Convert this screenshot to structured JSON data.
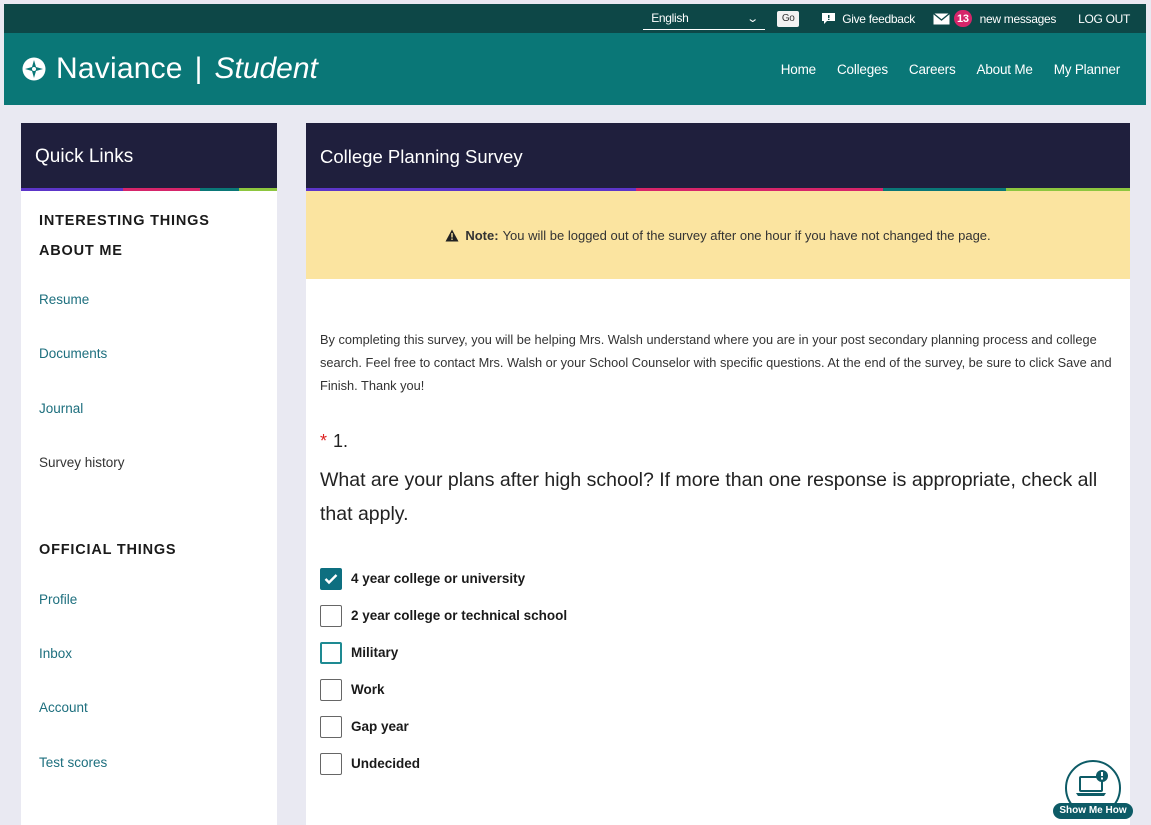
{
  "topbar": {
    "language": "English",
    "go_label": "Go",
    "feedback_label": "Give feedback",
    "message_count": "13",
    "messages_label": "new messages",
    "logout_label": "LOG OUT"
  },
  "header": {
    "brand_name": "Naviance",
    "brand_separator": "|",
    "brand_product": "Student",
    "nav": [
      "Home",
      "Colleges",
      "Careers",
      "About Me",
      "My Planner"
    ]
  },
  "sidebar": {
    "title": "Quick Links",
    "section1_title": "INTERESTING THINGS ABOUT ME",
    "section1_links": [
      "Resume",
      "Documents",
      "Journal",
      "Survey history"
    ],
    "section2_title": "OFFICIAL THINGS",
    "section2_links": [
      "Profile",
      "Inbox",
      "Account",
      "Test scores"
    ]
  },
  "survey": {
    "title": "College Planning Survey",
    "note_prefix": "Note:",
    "note_text": "You will be logged out of the survey after one hour if you have not changed the page.",
    "intro": "By completing this survey, you will be helping Mrs. Walsh understand where you are in your post secondary planning process and college search. Feel free to contact Mrs. Walsh or your School Counselor with specific questions. At the end of the survey, be sure to click Save and Finish. Thank you!",
    "question_required_marker": "*",
    "question_number": "1.",
    "question_text": "What are your plans after high school?  If more than one response is appropriate, check all that apply.",
    "options": [
      {
        "label": "4 year college or university",
        "checked": true
      },
      {
        "label": "2 year college or technical school",
        "checked": false
      },
      {
        "label": "Military",
        "checked": false
      },
      {
        "label": "Work",
        "checked": false
      },
      {
        "label": "Gap year",
        "checked": false
      },
      {
        "label": "Undecided",
        "checked": false
      }
    ]
  },
  "help": {
    "show_me_how_label": "Show Me How"
  },
  "colors": {
    "topbar": "#0d4747",
    "header": "#0a7777",
    "panel_head": "#1f1f3d",
    "note_bg": "#fbe4a0",
    "link": "#1d6f7e",
    "checkbox_checked": "#0d6f80",
    "badge": "#d6256a"
  }
}
